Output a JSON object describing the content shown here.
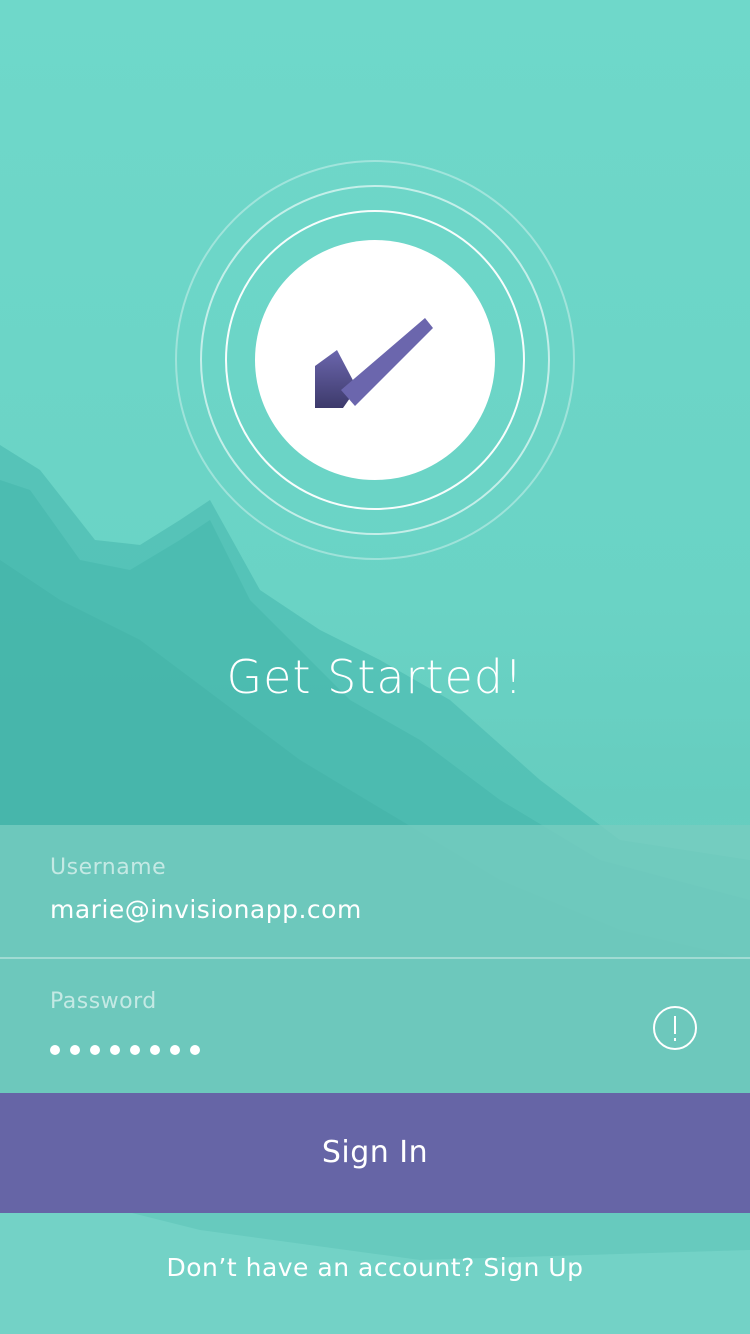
{
  "colors": {
    "accent": "#6665a6",
    "background": "#6dd5c7",
    "check": "#6b66ad"
  },
  "hero": {
    "logo_icon": "checkmark-icon",
    "title": "Get Started!"
  },
  "form": {
    "username": {
      "label": "Username",
      "value": "marie@invisionapp.com"
    },
    "password": {
      "label": "Password",
      "masked_length": 8,
      "status_icon": "alert-icon"
    }
  },
  "actions": {
    "sign_in_label": "Sign In"
  },
  "footer": {
    "prompt": "Don’t have an account?",
    "sign_up_label": "Sign Up"
  }
}
